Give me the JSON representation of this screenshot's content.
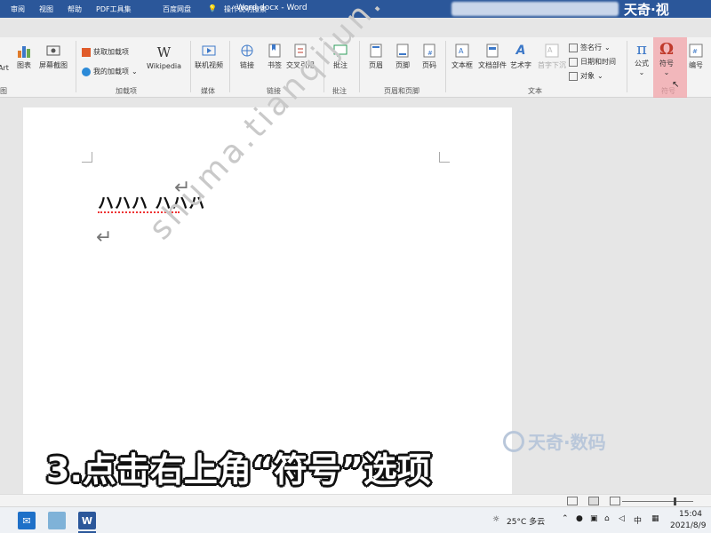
{
  "titlebar": {
    "tabs": [
      "审阅",
      "视图",
      "帮助",
      "PDF工具集",
      "百度网盘"
    ],
    "tell_me": "操作说明搜索",
    "title": "Word.docx  -  Word",
    "brand": "天奇·视"
  },
  "ribbon": {
    "buttons": {
      "art": "Art",
      "chart": "图表",
      "screenshot": "屏幕截图",
      "get_addins": "获取加载项",
      "my_addins": "我的加载项",
      "wikipedia": "Wikipedia",
      "online_video": "联机视频",
      "link": "链接",
      "bookmark": "书签",
      "crossref": "交叉引用",
      "comment": "批注",
      "header": "页眉",
      "footer": "页脚",
      "page_number": "页码",
      "textbox": "文本框",
      "doc_parts": "文档部件",
      "wordart": "艺术字",
      "dropcap": "首字下沉",
      "signature_line": "签名行",
      "datetime": "日期和时间",
      "object": "对象",
      "equation": "公式",
      "symbol": "符号",
      "numbering": "编号"
    },
    "groups": {
      "illustrations": "图",
      "addins": "加载项",
      "media": "媒体",
      "links": "链接",
      "comments": "批注",
      "header_footer": "页眉和页脚",
      "text": "文本",
      "symbols": "符号"
    },
    "icons": {
      "wikipedia": "W",
      "equation": "π",
      "symbol": "Ω"
    }
  },
  "document": {
    "text": "ハハハ ハハハ",
    "watermark": "shuma.tianqijun.com",
    "caption": "3.点击右上角“符号”选项",
    "brand_watermark": "天奇·数码"
  },
  "taskbar": {
    "weather": "25°C 多云",
    "ime": "中",
    "time": "15:04",
    "date": "2021/8/9"
  },
  "colors": {
    "word_blue": "#2b579a",
    "symbol_highlight": "#f2a3a8",
    "symbol_red": "#c0392b"
  }
}
